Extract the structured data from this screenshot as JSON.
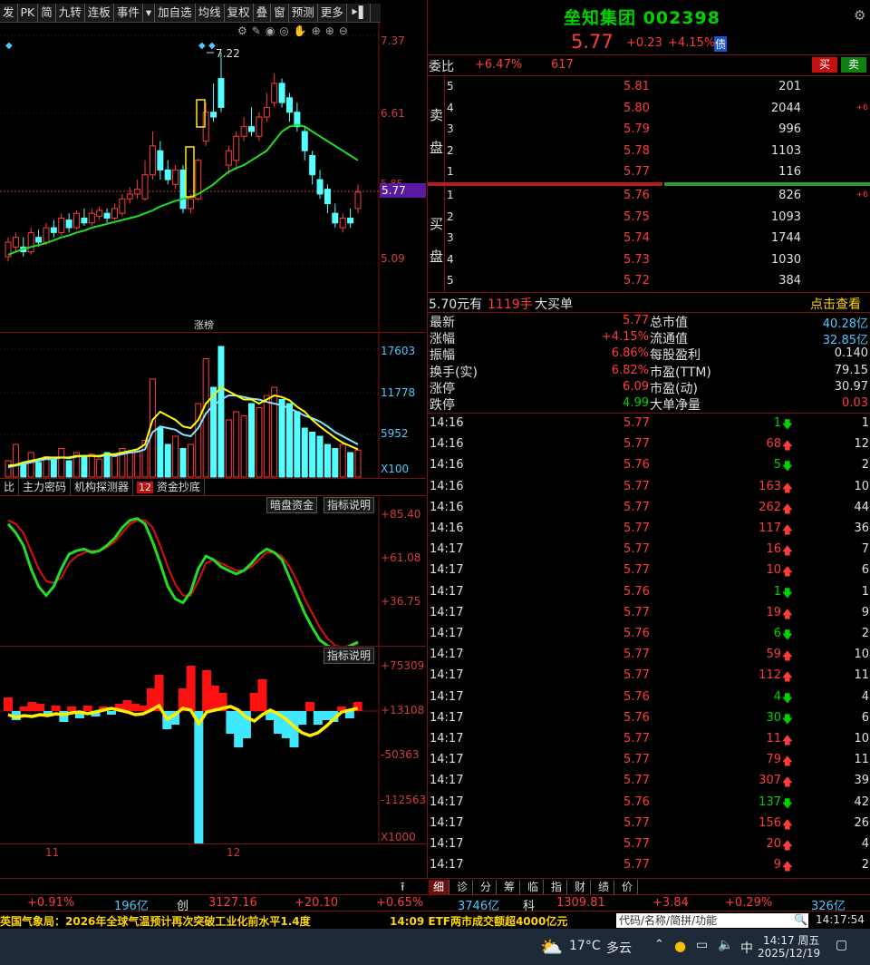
{
  "toolbar": [
    "发",
    "PK",
    "简",
    "九转",
    "连板",
    "事件",
    "▾",
    "加自选",
    "均线",
    "复权",
    "叠",
    "窗",
    "预测",
    "更多",
    "⯈▌"
  ],
  "price_axis": [
    "7.37",
    "6.61",
    "5.77",
    "5.09",
    "5.85"
  ],
  "high_label": "7.22",
  "zhangbang": "涨榜",
  "vol_axis": [
    "17603",
    "11778",
    "5952",
    "X100"
  ],
  "tabs": [
    "比",
    "主力密码",
    "机构探测器",
    "12",
    "资金抄底"
  ],
  "osc_buttons": [
    "暗盘资金",
    "指标说明"
  ],
  "osc_axis": [
    "+85.40",
    "+61.08",
    "+36.75"
  ],
  "flow_button": "指标说明",
  "flow_axis": [
    "+75309",
    "+13108",
    "-50363",
    "-112563",
    "X1000"
  ],
  "date_axis": [
    "11",
    "12"
  ],
  "stock": {
    "name": "垒知集团",
    "code": "002398",
    "price": "5.77",
    "change": "+0.23",
    "pct": "+4.15%",
    "bond": "债"
  },
  "weibi": {
    "label": "委比",
    "pct": "+6.47%",
    "val": "617",
    "buy": "买",
    "sell": "卖"
  },
  "sell_label": [
    "卖",
    "盘"
  ],
  "buy_label": [
    "买",
    "盘"
  ],
  "asks": [
    {
      "lv": "5",
      "p": "5.81",
      "v": "201",
      "x": ""
    },
    {
      "lv": "4",
      "p": "5.80",
      "v": "2044",
      "x": "+6"
    },
    {
      "lv": "3",
      "p": "5.79",
      "v": "996",
      "x": ""
    },
    {
      "lv": "2",
      "p": "5.78",
      "v": "1103",
      "x": ""
    },
    {
      "lv": "1",
      "p": "5.77",
      "v": "116",
      "x": ""
    }
  ],
  "bids": [
    {
      "lv": "1",
      "p": "5.76",
      "v": "826",
      "x": "+6"
    },
    {
      "lv": "2",
      "p": "5.75",
      "v": "1093",
      "x": ""
    },
    {
      "lv": "3",
      "p": "5.74",
      "v": "1744",
      "x": ""
    },
    {
      "lv": "4",
      "p": "5.73",
      "v": "1030",
      "x": ""
    },
    {
      "lv": "5",
      "p": "5.72",
      "v": "384",
      "x": ""
    }
  ],
  "bigorder": {
    "price": "5.70元有",
    "qty": "1119手",
    "label": "大买单",
    "link": "点击查看"
  },
  "stats": [
    {
      "l": "最新",
      "v": "5.77",
      "r": "总市值",
      "rv": "40.28亿"
    },
    {
      "l": "涨幅",
      "v": "+4.15%",
      "r": "流通值",
      "rv": "32.85亿"
    },
    {
      "l": "振幅",
      "v": "6.86%",
      "r": "每股盈利",
      "rv": "0.140"
    },
    {
      "l": "换手(实)",
      "v": "6.82%",
      "r": "市盈(TTM)",
      "rv": "79.15"
    },
    {
      "l": "涨停",
      "v": "6.09",
      "r": "市盈(动)",
      "rv": "30.97"
    },
    {
      "l": "跌停",
      "v": "4.99",
      "r": "大单净量",
      "rv": "0.03"
    }
  ],
  "ticks": [
    {
      "t": "14:16",
      "p": "5.77",
      "v": "1",
      "d": "down",
      "n": "1"
    },
    {
      "t": "14:16",
      "p": "5.77",
      "v": "68",
      "d": "up",
      "n": "12"
    },
    {
      "t": "14:16",
      "p": "5.76",
      "v": "5",
      "d": "down",
      "n": "2"
    },
    {
      "t": "14:16",
      "p": "5.77",
      "v": "163",
      "d": "up",
      "n": "10"
    },
    {
      "t": "14:16",
      "p": "5.77",
      "v": "262",
      "d": "up",
      "n": "44"
    },
    {
      "t": "14:16",
      "p": "5.77",
      "v": "117",
      "d": "up",
      "n": "36"
    },
    {
      "t": "14:17",
      "p": "5.77",
      "v": "16",
      "d": "up",
      "n": "7"
    },
    {
      "t": "14:17",
      "p": "5.77",
      "v": "10",
      "d": "up",
      "n": "6"
    },
    {
      "t": "14:17",
      "p": "5.76",
      "v": "1",
      "d": "down",
      "n": "1"
    },
    {
      "t": "14:17",
      "p": "5.77",
      "v": "19",
      "d": "up",
      "n": "9"
    },
    {
      "t": "14:17",
      "p": "5.76",
      "v": "6",
      "d": "down",
      "n": "2"
    },
    {
      "t": "14:17",
      "p": "5.77",
      "v": "59",
      "d": "up",
      "n": "10"
    },
    {
      "t": "14:17",
      "p": "5.77",
      "v": "112",
      "d": "up",
      "n": "11"
    },
    {
      "t": "14:17",
      "p": "5.76",
      "v": "4",
      "d": "down",
      "n": "4"
    },
    {
      "t": "14:17",
      "p": "5.76",
      "v": "30",
      "d": "down",
      "n": "6"
    },
    {
      "t": "14:17",
      "p": "5.77",
      "v": "11",
      "d": "up",
      "n": "10"
    },
    {
      "t": "14:17",
      "p": "5.77",
      "v": "79",
      "d": "up",
      "n": "11"
    },
    {
      "t": "14:17",
      "p": "5.77",
      "v": "307",
      "d": "up",
      "n": "39"
    },
    {
      "t": "14:17",
      "p": "5.76",
      "v": "137",
      "d": "down",
      "n": "42"
    },
    {
      "t": "14:17",
      "p": "5.77",
      "v": "156",
      "d": "up",
      "n": "26"
    },
    {
      "t": "14:17",
      "p": "5.77",
      "v": "20",
      "d": "up",
      "n": "4"
    },
    {
      "t": "14:17",
      "p": "5.77",
      "v": "9",
      "d": "up",
      "n": "2"
    }
  ],
  "bottom_tabs": [
    "细",
    "诊",
    "分",
    "筹",
    "临",
    "指",
    "财",
    "绩",
    "价"
  ],
  "index_bar": {
    "a": "+0.91%",
    "b": "196亿",
    "c": "创",
    "d": "3127.16",
    "e": "+20.10",
    "f": "+0.65%",
    "g": "3746亿",
    "h": "科",
    "i": "1309.81",
    "j": "+3.84",
    "k": "+0.29%",
    "l": "326亿"
  },
  "news": {
    "left": "英国气象局：2026年全球气温预计再次突破工业化前水平1.4度",
    "right": "14:09 ETF两市成交额超4000亿元",
    "search": "代码/名称/简拼/功能",
    "clock": "14:17:54"
  },
  "taskbar": {
    "temp": "17°C",
    "weather": "多云",
    "ime": "中",
    "time": "14:17 周五",
    "date": "2025/12/19"
  }
}
